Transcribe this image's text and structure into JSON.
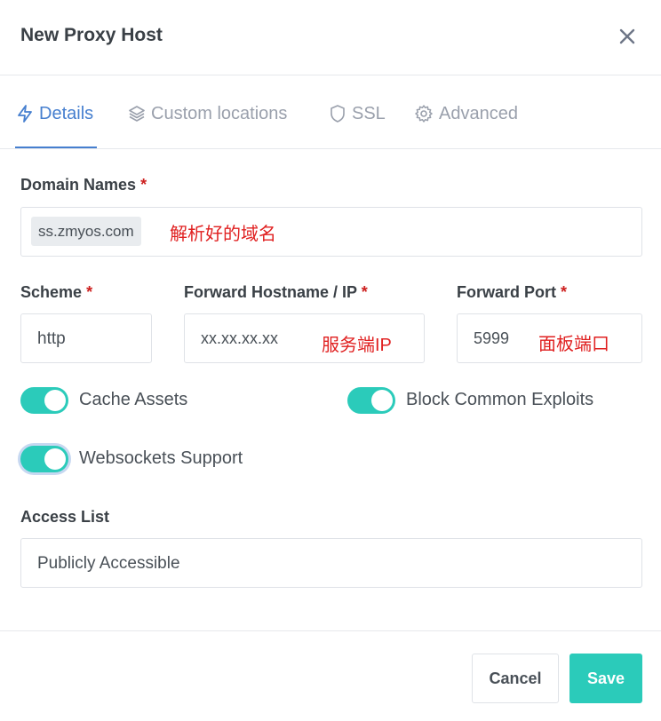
{
  "modal": {
    "title": "New Proxy Host"
  },
  "tabs": [
    {
      "label": "Details",
      "icon": "bolt-icon",
      "active": true
    },
    {
      "label": "Custom locations",
      "icon": "layers-icon",
      "active": false
    },
    {
      "label": "SSL",
      "icon": "shield-icon",
      "active": false
    },
    {
      "label": "Advanced",
      "icon": "gear-icon",
      "active": false
    }
  ],
  "form": {
    "domain_names": {
      "label": "Domain Names",
      "required": "*",
      "chip": "ss.zmyos.com",
      "annotation": "解析好的域名"
    },
    "scheme": {
      "label": "Scheme",
      "required": "*",
      "value": "http"
    },
    "forward_host": {
      "label": "Forward Hostname / IP",
      "required": "*",
      "value": "xx.xx.xx.xx",
      "annotation": "服务端IP"
    },
    "forward_port": {
      "label": "Forward Port",
      "required": "*",
      "value": "5999",
      "annotation": "面板端口"
    },
    "toggles": {
      "cache_assets": {
        "label": "Cache Assets",
        "on": true
      },
      "block_exploits": {
        "label": "Block Common Exploits",
        "on": true
      },
      "websockets": {
        "label": "Websockets Support",
        "on": true
      }
    },
    "access_list": {
      "label": "Access List",
      "value": "Publicly Accessible"
    }
  },
  "footer": {
    "cancel_label": "Cancel",
    "save_label": "Save"
  },
  "colors": {
    "accent": "#467fcf",
    "toggle_on": "#2bcbba",
    "required": "#cd201f",
    "annotation": "#e02020"
  }
}
